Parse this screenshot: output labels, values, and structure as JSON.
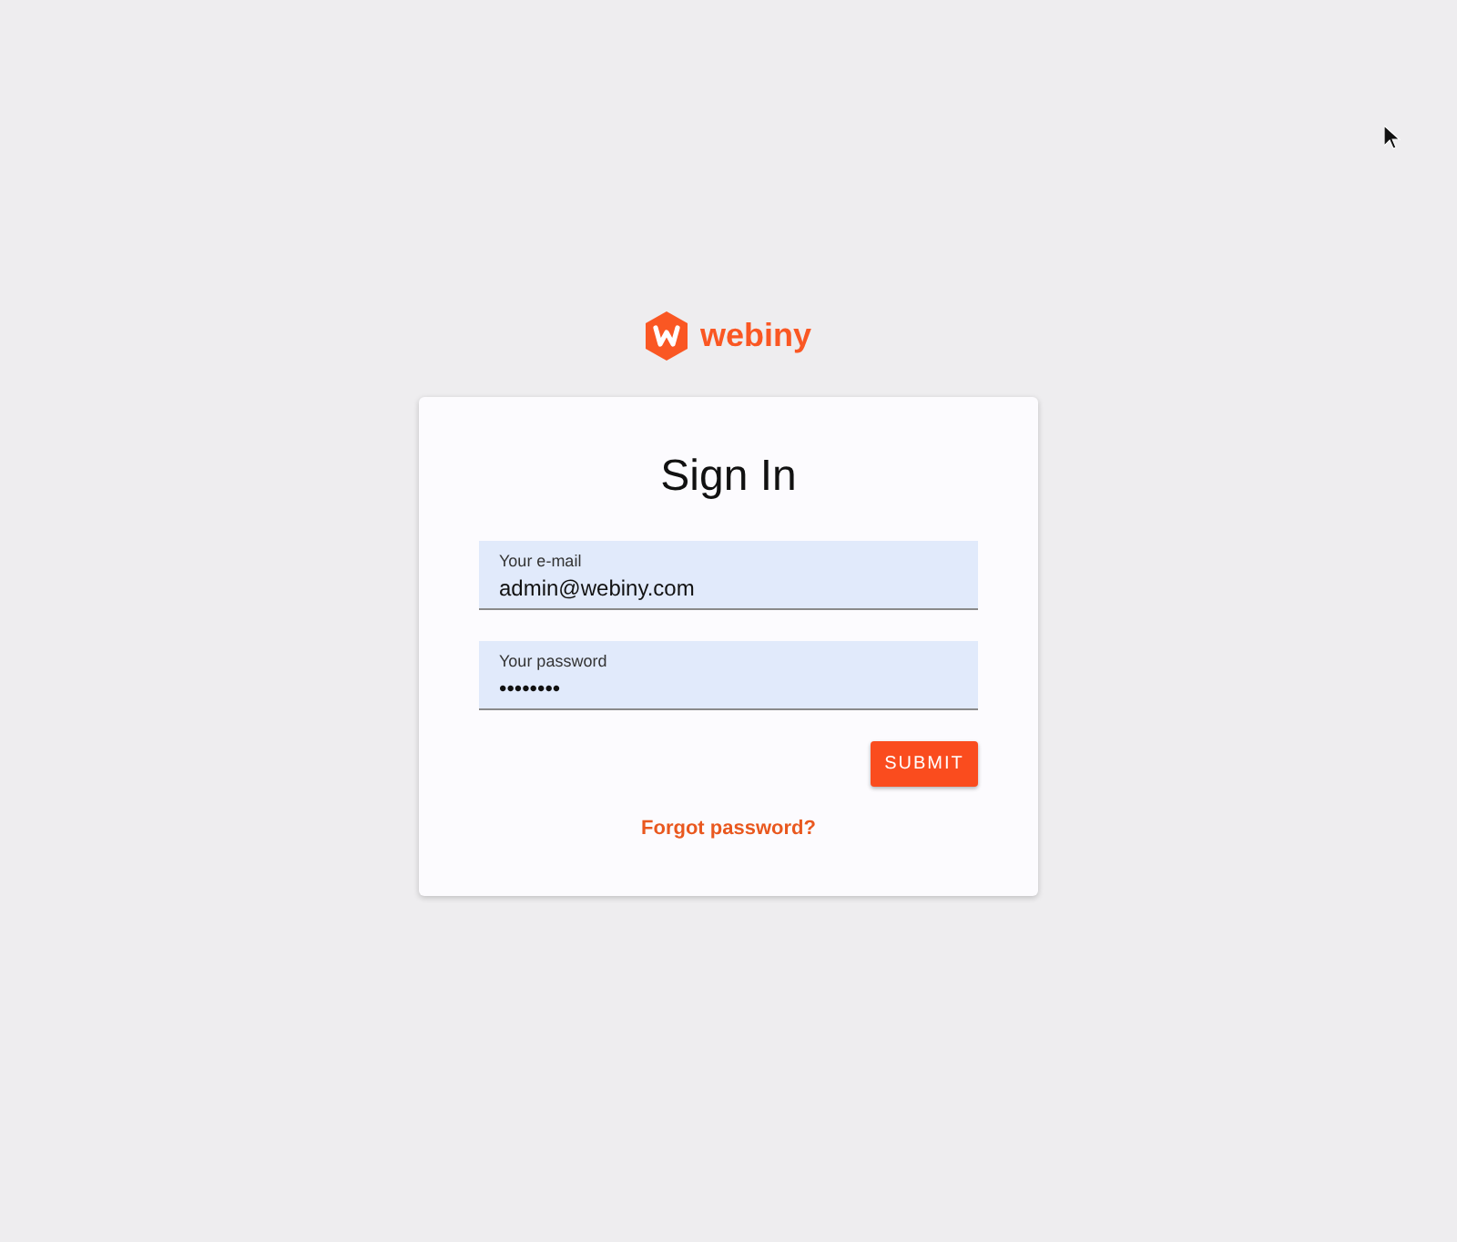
{
  "logo": {
    "text": "webiny"
  },
  "title": "Sign In",
  "fields": [
    {
      "label": "Your e-mail",
      "value": "admin@webiny.com"
    },
    {
      "label": "Your password",
      "value": "••••••••"
    }
  ],
  "submit": "SUBMIT",
  "forgot_link": "Forgot password?"
}
